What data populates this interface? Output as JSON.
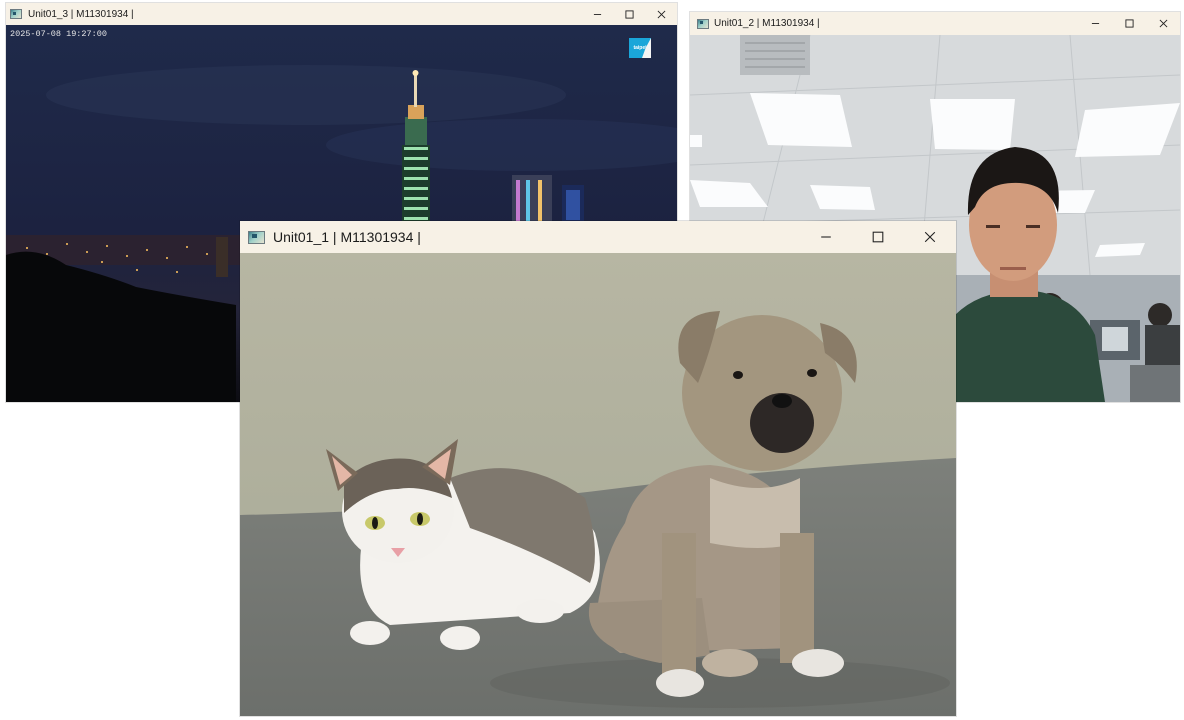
{
  "windows": [
    {
      "id": "w3",
      "title": "Unit01_3 | M11301934 |",
      "overlay_timestamp": "2025-07-08 19:27:00",
      "scene": "taipei-101-night-skyline"
    },
    {
      "id": "w2",
      "title": "Unit01_2 | M11301934 |",
      "scene": "office-webcam-man"
    },
    {
      "id": "w1",
      "title": "Unit01_1 | M11301934 |",
      "scene": "kitten-and-puppy"
    }
  ],
  "controls": {
    "minimize_icon": "minimize-icon",
    "maximize_icon": "maximize-icon",
    "close_icon": "close-icon"
  },
  "colors": {
    "titlebar": "#f7f1e6",
    "night_sky": "#1c2540",
    "ground": "#8a8d86"
  }
}
